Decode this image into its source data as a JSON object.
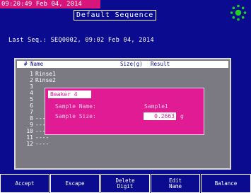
{
  "header": {
    "timestamp": "09:20:49 Feb 04, 2014",
    "title": "Default Sequence",
    "status_icon": "sunburst-icon"
  },
  "last_sequence": "Last Seq.: SEQ0002, 09:02 Feb 04, 2014",
  "table": {
    "columns": [
      "# Name",
      "Size(g)",
      "Result"
    ],
    "rows": [
      {
        "num": "1",
        "name": "Rinse1"
      },
      {
        "num": "2",
        "name": "Rinse2"
      },
      {
        "num": "3",
        "name": ""
      },
      {
        "num": "4",
        "name": ""
      },
      {
        "num": "5",
        "name": ""
      },
      {
        "num": "6",
        "name": ""
      },
      {
        "num": "7",
        "name": ""
      },
      {
        "num": "8",
        "name": "----"
      },
      {
        "num": "9",
        "name": "----"
      },
      {
        "num": "10",
        "name": "----"
      },
      {
        "num": "11",
        "name": "----"
      },
      {
        "num": "12",
        "name": "----"
      }
    ]
  },
  "dialog": {
    "title": "Beaker 4",
    "sample_name_label": "Sample Name:",
    "sample_name_value": "Sample1",
    "sample_size_label": "Sample Size:",
    "sample_size_value": "0.2663",
    "sample_size_unit": "g"
  },
  "softkeys": [
    {
      "label": "Accept"
    },
    {
      "label": "Escape"
    },
    {
      "label": "Delete\nDigit"
    },
    {
      "label": "Edit\nName"
    },
    {
      "label": "Balance"
    }
  ],
  "colors": {
    "background": "#0a0b8e",
    "accent": "#d8157a",
    "dialog": "#e11b93",
    "panel": "#7b7a83",
    "status_indicator": "#1ed31e"
  }
}
